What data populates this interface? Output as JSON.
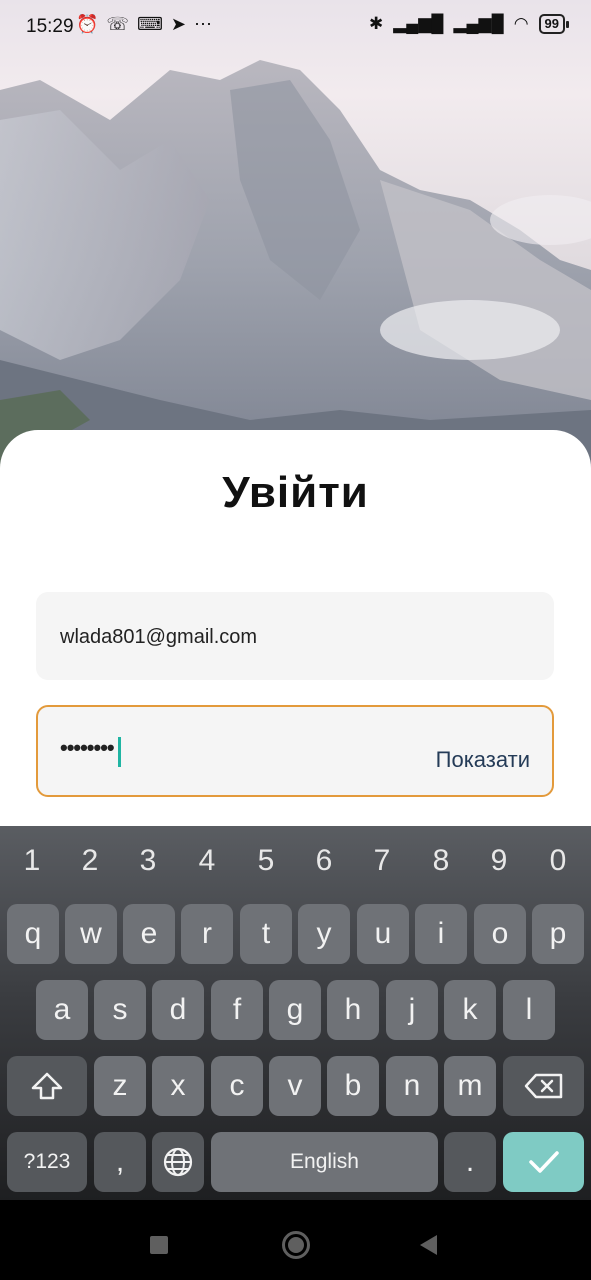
{
  "status_bar": {
    "time": "15:29",
    "left_icons": [
      "alarm-icon",
      "viber-icon",
      "keyboard-icon",
      "telegram-icon",
      "more-icon"
    ],
    "right_icons": [
      "bluetooth-icon",
      "signal-icon",
      "signal-icon",
      "wifi-icon"
    ],
    "battery": "99"
  },
  "login": {
    "title": "Увійти",
    "email_value": "wlada801@gmail.com",
    "password_value": "••••••••",
    "show_label": "Показати"
  },
  "keyboard": {
    "numbers": [
      "1",
      "2",
      "3",
      "4",
      "5",
      "6",
      "7",
      "8",
      "9",
      "0"
    ],
    "row1": [
      "q",
      "w",
      "e",
      "r",
      "t",
      "y",
      "u",
      "i",
      "o",
      "p"
    ],
    "row2": [
      "a",
      "s",
      "d",
      "f",
      "g",
      "h",
      "j",
      "k",
      "l"
    ],
    "row3": [
      "z",
      "x",
      "c",
      "v",
      "b",
      "n",
      "m"
    ],
    "sym_label": "?123",
    "comma": ",",
    "space_label": "English",
    "period": "."
  },
  "colors": {
    "focus_border": "#e39a3b",
    "caret": "#1fb5a3",
    "enter_key": "#7fcbc4"
  }
}
